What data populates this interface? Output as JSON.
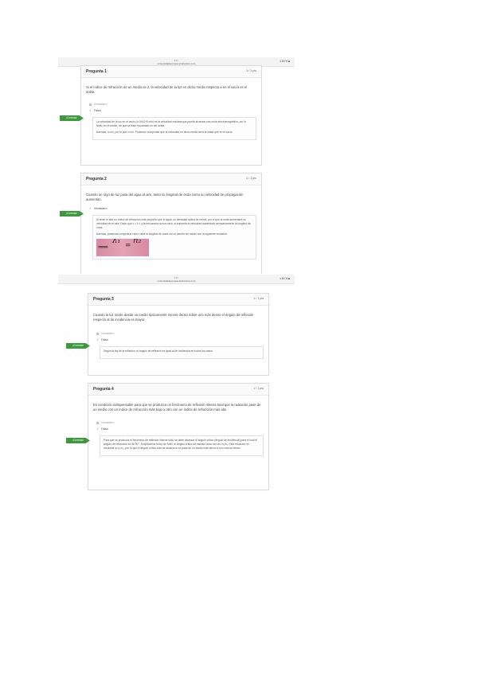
{
  "browser": {
    "dots": "•••",
    "url": "universidadeuropea.instructure.com",
    "status_icons": "▾ 60 % ■"
  },
  "questions": [
    {
      "title": "Pregunta 1",
      "points": "1 / 1 pts",
      "text": "Si el índice de refracción de un medio es 2, la velocidad de la luz en dicho medio respecto a en el vacío es el doble.",
      "option_false": "Verdadero",
      "option_selected": "Falso",
      "badge": "¡Correcto!",
      "explanation": [
        "La velocidad de la luz en el vacío (c=3x10^8 m/s) es la velocidad máxima que puede alcanzar una onda electromagnética, por lo tanto, en el medio, de que se trate ha pasado en del doble.",
        "Además, n=c/v, por lo que v=c/n. Podemos comprobar que la velocidad en dicho medio será la mitad que en el vacío."
      ]
    },
    {
      "title": "Pregunta 2",
      "points": "1 / 1 pts",
      "text": "Cuando un rayo de luz pasa del agua al aire, tanto su longitud de onda como su velocidad de propagación aumentan.",
      "option_selected": "Verdadero",
      "badge": "¡Correcto!",
      "explanation": [
        "Al tener el aire un índice de refracción más pequeño que el agua, su densidad óptica es menor, por lo que la onda aumentará su velocidad en el aire. Dado que v = λ·f, y la frecuencia nunca varía, si aumenta la velocidad aumentará necesariamente la longitud de onda.",
        "Además, podemos comprobar cómo varía la longitud de onda con el cambio de medio con la siguiente ecuación:"
      ],
      "formula": {
        "lhs": "λ₁",
        "eq": "=",
        "rhs": "n₂",
        "arrow": "⟹"
      }
    },
    {
      "title": "Pregunta 3",
      "points": "1 / 1 pts",
      "text": "Cuando la luz incide desde un medio ópticamente menos denso sobre uno más denso el ángulo de reflexión respecto al de incidencia es mayor.",
      "option_false": "Verdadero",
      "option_selected": "Falso",
      "badge": "¡Correcto!",
      "explanation": [
        "Según la ley de la reflexión, el ángulo de reflexión es igual al de incidencia en todos los casos."
      ]
    },
    {
      "title": "Pregunta 4",
      "points": "1 / 1 pts",
      "text": "Es condición indispensable para que se produzca un fenómeno de reflexión interna total que la radiación pase de un medio con un índice de refracción más bajo a otro con un índice de refracción más alto.",
      "option_false": "Verdadero",
      "option_selected": "Falso",
      "badge": "¡Correcto!",
      "explanation": [
        "Para que se produzca el fenómeno de reflexión interna total, se debe alcanzar el ángulo crítico (ángulo de incidencia) para el cual el ángulo de refracción es de 90°. Si aplicamos la ley de Snell, el ángulo crítico se calcula como sen θc=n₂/n₁. Esta ecuación es resoluble si n₁>n₂, por lo que el ángulo crítico sólo se alcanza si se pasa de un medio más denso a uno menos denso."
      ]
    }
  ],
  "side_marks": [
    "«",
    "«"
  ],
  "colors": {
    "accent_green": "#3c9a3c"
  }
}
